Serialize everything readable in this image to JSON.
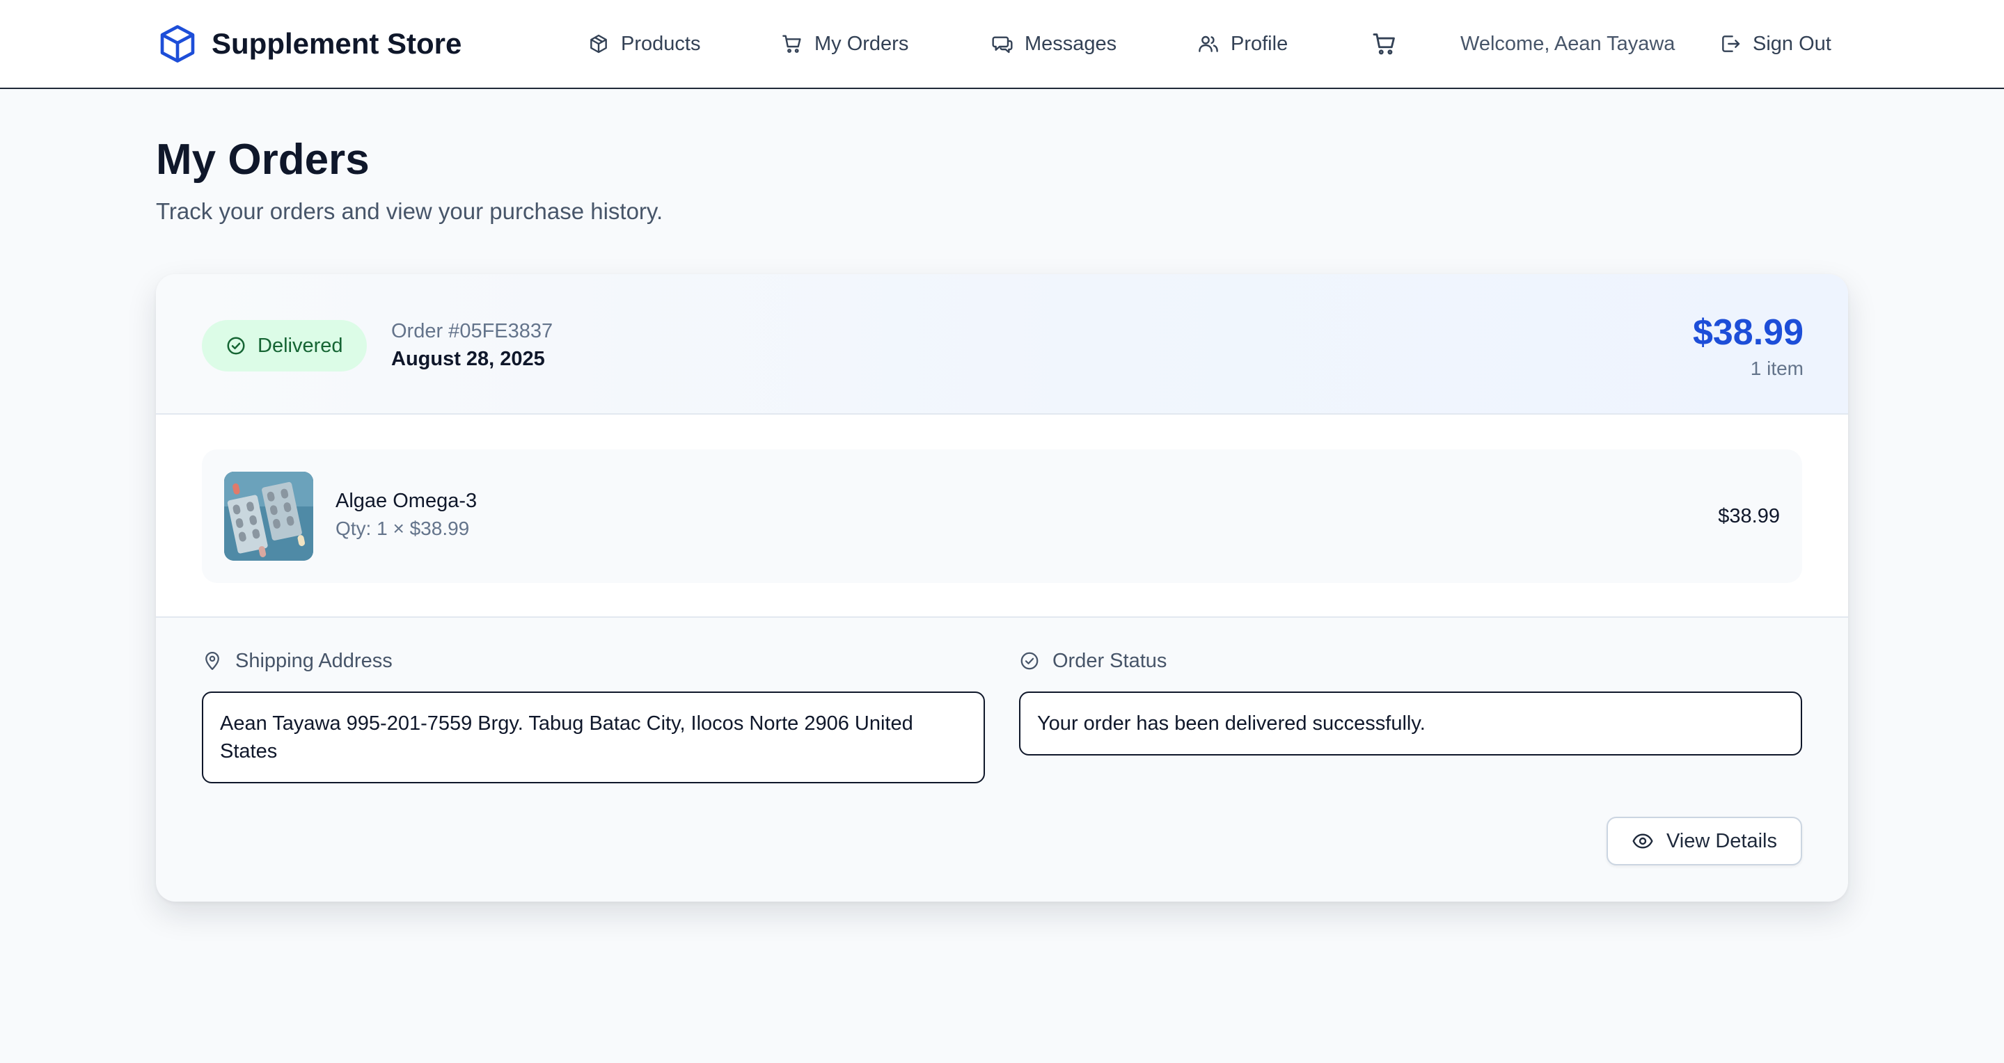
{
  "header": {
    "brand_name": "Supplement Store",
    "nav": {
      "products": "Products",
      "my_orders": "My Orders",
      "messages": "Messages",
      "profile": "Profile"
    },
    "welcome": "Welcome, Aean Tayawa",
    "sign_out": "Sign Out"
  },
  "page": {
    "title": "My Orders",
    "subtitle": "Track your orders and view your purchase history."
  },
  "orders": [
    {
      "status": "Delivered",
      "order_number": "Order #05FE3837",
      "date": "August 28, 2025",
      "total": "$38.99",
      "item_count": "1 item",
      "items": [
        {
          "name": "Algae Omega-3",
          "qty_line": "Qty: 1 × $38.99",
          "price": "$38.99"
        }
      ],
      "shipping_label": "Shipping Address",
      "shipping_address": "Aean Tayawa 995-201-7559 Brgy. Tabug Batac City, Ilocos Norte 2906 United States",
      "status_label": "Order Status",
      "status_message": "Your order has been delivered successfully.",
      "view_details": "View Details"
    }
  ],
  "icons": {
    "brand": "cube-icon",
    "products": "package-icon",
    "my_orders": "cart-icon",
    "messages": "chat-icon",
    "profile": "users-icon",
    "cart": "cart-icon",
    "sign_out": "logout-icon",
    "status": "check-circle-icon",
    "shipping": "map-pin-icon",
    "view": "eye-icon"
  },
  "colors": {
    "accent": "#1d4ed8",
    "delivered_bg": "#dcfce7",
    "delivered_text": "#166534",
    "page_bg": "#f8fafc"
  }
}
